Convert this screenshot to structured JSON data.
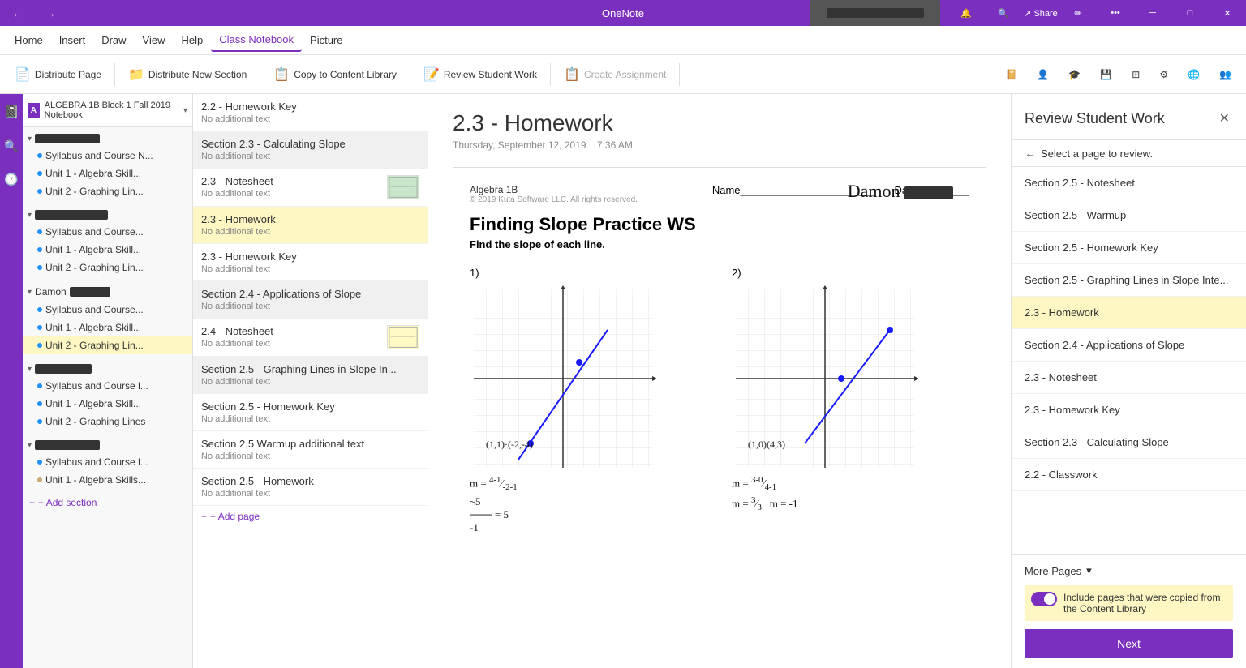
{
  "titlebar": {
    "title": "OneNote",
    "min": "─",
    "max": "□",
    "close": "✕"
  },
  "menubar": {
    "items": [
      {
        "label": "Home",
        "active": false
      },
      {
        "label": "Insert",
        "active": false
      },
      {
        "label": "Draw",
        "active": false
      },
      {
        "label": "View",
        "active": false
      },
      {
        "label": "Help",
        "active": false
      },
      {
        "label": "Class Notebook",
        "active": true
      },
      {
        "label": "Picture",
        "active": false
      }
    ]
  },
  "toolbar": {
    "buttons": [
      {
        "label": "Distribute Page",
        "icon": "📄",
        "disabled": false
      },
      {
        "label": "Distribute New Section",
        "icon": "📁",
        "disabled": false
      },
      {
        "label": "Copy to Content Library",
        "icon": "📋",
        "disabled": false
      },
      {
        "label": "Review Student Work",
        "icon": "📝",
        "disabled": false
      },
      {
        "label": "Create Assignment",
        "icon": "📋",
        "disabled": true
      }
    ]
  },
  "notebook": {
    "title": "ALGEBRA 1B Block 1 Fall 2019 Notebook"
  },
  "sidebar": {
    "groups": [
      {
        "name": "redacted1",
        "items": [
          {
            "name": "Syllabus and Course N...",
            "sub": "",
            "dot": "blue"
          },
          {
            "name": "Unit 1 - Algebra Skill...",
            "sub": "",
            "dot": "blue"
          },
          {
            "name": "Unit 2 - Graphing Lin...",
            "sub": "",
            "dot": "blue"
          }
        ]
      },
      {
        "name": "redacted2",
        "items": [
          {
            "name": "Syllabus and Course...",
            "sub": "",
            "dot": "blue"
          },
          {
            "name": "Unit 1 - Algebra Skill...",
            "sub": "",
            "dot": "blue"
          },
          {
            "name": "Unit 2 - Graphing Lin...",
            "sub": "",
            "dot": "blue"
          }
        ]
      },
      {
        "name": "Damon redacted",
        "items": [
          {
            "name": "Syllabus and Course...",
            "sub": "",
            "dot": "blue"
          },
          {
            "name": "Unit 1 - Algebra Skill...",
            "sub": "",
            "dot": "blue"
          },
          {
            "name": "Unit 2 - Graphing Lin...",
            "sub": "",
            "dot": "blue",
            "active": true
          }
        ]
      },
      {
        "name": "redacted3",
        "items": [
          {
            "name": "Syllabus and Course l...",
            "sub": "",
            "dot": "blue"
          },
          {
            "name": "Unit 1 - Algebra Skill...",
            "sub": "",
            "dot": "blue"
          },
          {
            "name": "Unit 2 - Graphing Lines",
            "sub": "",
            "dot": "blue"
          }
        ]
      },
      {
        "name": "redacted4",
        "items": [
          {
            "name": "Syllabus and Course l...",
            "sub": "",
            "dot": "blue"
          },
          {
            "name": "Unit 1 - Algebra Skills...",
            "sub": "",
            "dot": "tan"
          }
        ]
      }
    ],
    "add_section": "+ Add section"
  },
  "section_panel": {
    "items": [
      {
        "name": "2.2 - Homework Key",
        "sub": "No additional text",
        "thumb": false,
        "section_head": null
      },
      {
        "name": "Section 2.3 - Calculating Slope",
        "sub": "No additional text",
        "thumb": false,
        "is_section": true
      },
      {
        "name": "2.3 - Notesheet",
        "sub": "No additional text",
        "thumb": true,
        "thumb_type": "green"
      },
      {
        "name": "2.3 - Homework",
        "sub": "No additional text",
        "thumb": false,
        "active": true
      },
      {
        "name": "2.3 - Homework Key",
        "sub": "No additional text",
        "thumb": false
      },
      {
        "name": "Section 2.4 - Applications of Slope",
        "sub": "No additional text",
        "thumb": false,
        "is_section": true
      },
      {
        "name": "2.4 - Notesheet",
        "sub": "No additional text",
        "thumb": true,
        "thumb_type": "yellow"
      },
      {
        "name": "Section 2.5 - Graphing Lines in Slope In...",
        "sub": "No additional text",
        "thumb": false,
        "is_section": true
      },
      {
        "name": "Section 2.5 - Homework Key",
        "sub": "No additional text",
        "thumb": false
      },
      {
        "name": "Section 2.5 - Warmup",
        "sub": "No additional text",
        "thumb": false
      },
      {
        "name": "Section 2.5 - Homework",
        "sub": "No additional text",
        "thumb": false
      }
    ],
    "add_page": "+ Add page"
  },
  "main_content": {
    "page_title": "2.3 - Homework",
    "date": "Thursday, September 12, 2019",
    "time": "7:36 AM",
    "sheet": {
      "course": "Algebra 1B",
      "copyright": "© 2019 Kuta Software LLC.  All rights reserved.",
      "title": "Finding Slope Practice WS",
      "name_label": "Name",
      "date_label": "Date",
      "directions": "Find the slope of each line.",
      "problem1_label": "1)",
      "problem2_label": "2)"
    }
  },
  "review_panel": {
    "title": "Review Student Work",
    "back_text": "Select a page to review.",
    "items": [
      {
        "label": "Section 2.5 - Notesheet",
        "active": false
      },
      {
        "label": "Section 2.5 - Warmup",
        "active": false
      },
      {
        "label": "Section 2.5 - Homework Key",
        "active": false
      },
      {
        "label": "Section 2.5 - Graphing Lines in Slope Inte...",
        "active": false
      },
      {
        "label": "2.3 - Homework",
        "active": true
      },
      {
        "label": "Section 2.4 - Applications of Slope",
        "active": false
      },
      {
        "label": "2.3 - Notesheet",
        "active": false
      },
      {
        "label": "2.3 - Homework Key",
        "active": false
      },
      {
        "label": "Section 2.3 - Calculating Slope",
        "active": false
      },
      {
        "label": "2.2 - Classwork",
        "active": false
      }
    ],
    "more_pages_label": "More Pages",
    "include_label": "Include pages that were copied from the Content Library",
    "next_label": "Next"
  }
}
